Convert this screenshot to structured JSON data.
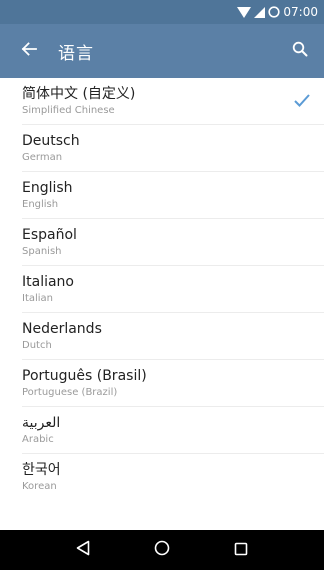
{
  "status_bar": {
    "time": "07:00",
    "icons": [
      "wifi-icon",
      "signal-icon",
      "battery-icon"
    ]
  },
  "app_bar": {
    "title": "语言",
    "back_icon": "arrow-left-icon",
    "search_icon": "search-icon"
  },
  "languages": [
    {
      "name": "简体中文 (自定义)",
      "subtitle": "Simplified Chinese",
      "selected": true
    },
    {
      "name": "Deutsch",
      "subtitle": "German",
      "selected": false
    },
    {
      "name": "English",
      "subtitle": "English",
      "selected": false
    },
    {
      "name": "Español",
      "subtitle": "Spanish",
      "selected": false
    },
    {
      "name": "Italiano",
      "subtitle": "Italian",
      "selected": false
    },
    {
      "name": "Nederlands",
      "subtitle": "Dutch",
      "selected": false
    },
    {
      "name": "Português (Brasil)",
      "subtitle": "Portuguese (Brazil)",
      "selected": false
    },
    {
      "name": "العربية",
      "subtitle": "Arabic",
      "selected": false
    },
    {
      "name": "한국어",
      "subtitle": "Korean",
      "selected": false
    }
  ],
  "nav_bar": {
    "icons": [
      "back-triangle-icon",
      "home-circle-icon",
      "recents-square-icon"
    ]
  },
  "colors": {
    "status_bar": "#4f7599",
    "app_bar": "#5b80a6",
    "check": "#5b9bd5",
    "nav_bar": "#000000"
  }
}
